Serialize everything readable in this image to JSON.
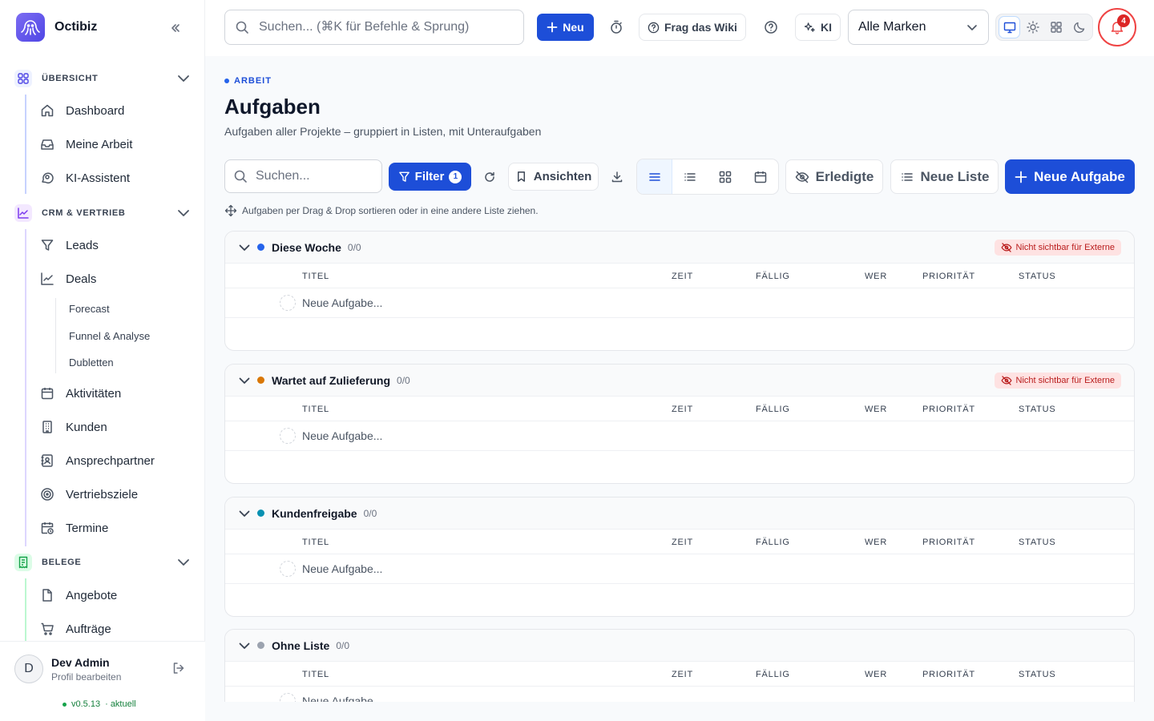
{
  "app": {
    "name": "Octibiz"
  },
  "sidebar": {
    "sections": [
      {
        "label": "ÜBERSICHT",
        "items": [
          "Dashboard",
          "Meine Arbeit",
          "KI-Assistent"
        ]
      },
      {
        "label": "CRM & VERTRIEB",
        "items": [
          "Leads",
          "Deals",
          "Aktivitäten",
          "Kunden",
          "Ansprechpartner",
          "Vertriebsziele",
          "Termine"
        ],
        "deal_subitems": [
          "Forecast",
          "Funnel & Analyse",
          "Dubletten"
        ]
      },
      {
        "label": "BELEGE",
        "items": [
          "Angebote",
          "Aufträge"
        ]
      }
    ],
    "footer": {
      "user_initial": "D",
      "user_name": "Dev Admin",
      "user_sub": "Profil bearbeiten",
      "version": "v0.5.13",
      "version_status": "· aktuell"
    }
  },
  "topbar": {
    "search_placeholder": "Suchen... (⌘K für Befehle & Sprung)",
    "new_label": "Neu",
    "wiki_label": "Frag das Wiki",
    "ai_label": "KI",
    "brand_select_value": "Alle Marken",
    "notification_count": "4"
  },
  "page": {
    "eyebrow": "ARBEIT",
    "title": "Aufgaben",
    "subtitle": "Aufgaben aller Projekte – gruppiert in Listen, mit Unteraufgaben",
    "search_placeholder": "Suchen...",
    "filter_label": "Filter",
    "filter_count": "1",
    "views_label": "Ansichten",
    "completed_label": "Erledigte",
    "new_list_label": "Neue Liste",
    "new_task_label": "Neue Aufgabe",
    "dnd_hint": "Aufgaben per Drag & Drop sortieren oder in eine andere Liste ziehen."
  },
  "columns": [
    "TITEL",
    "ZEIT",
    "FÄLLIG",
    "WER",
    "PRIORITÄT",
    "STATUS"
  ],
  "groups": [
    {
      "name": "Diese Woche",
      "count": "0/0",
      "color": "#2563eb",
      "badge": "Nicht sichtbar für Externe",
      "new_placeholder": "Neue Aufgabe..."
    },
    {
      "name": "Wartet auf Zulieferung",
      "count": "0/0",
      "color": "#d97706",
      "badge": "Nicht sichtbar für Externe",
      "new_placeholder": "Neue Aufgabe..."
    },
    {
      "name": "Kundenfreigabe",
      "count": "0/0",
      "color": "#0891b2",
      "badge": "",
      "new_placeholder": "Neue Aufgabe..."
    },
    {
      "name": "Ohne Liste",
      "count": "0/0",
      "color": "#9ca3af",
      "badge": "",
      "new_placeholder": "Neue Aufgabe..."
    }
  ],
  "colors": {
    "primary": "#1d4ed8",
    "danger": "#dc2626",
    "overview_accent": "#4f46e5",
    "crm_accent": "#7c3aed",
    "documents_accent": "#16a34a"
  }
}
